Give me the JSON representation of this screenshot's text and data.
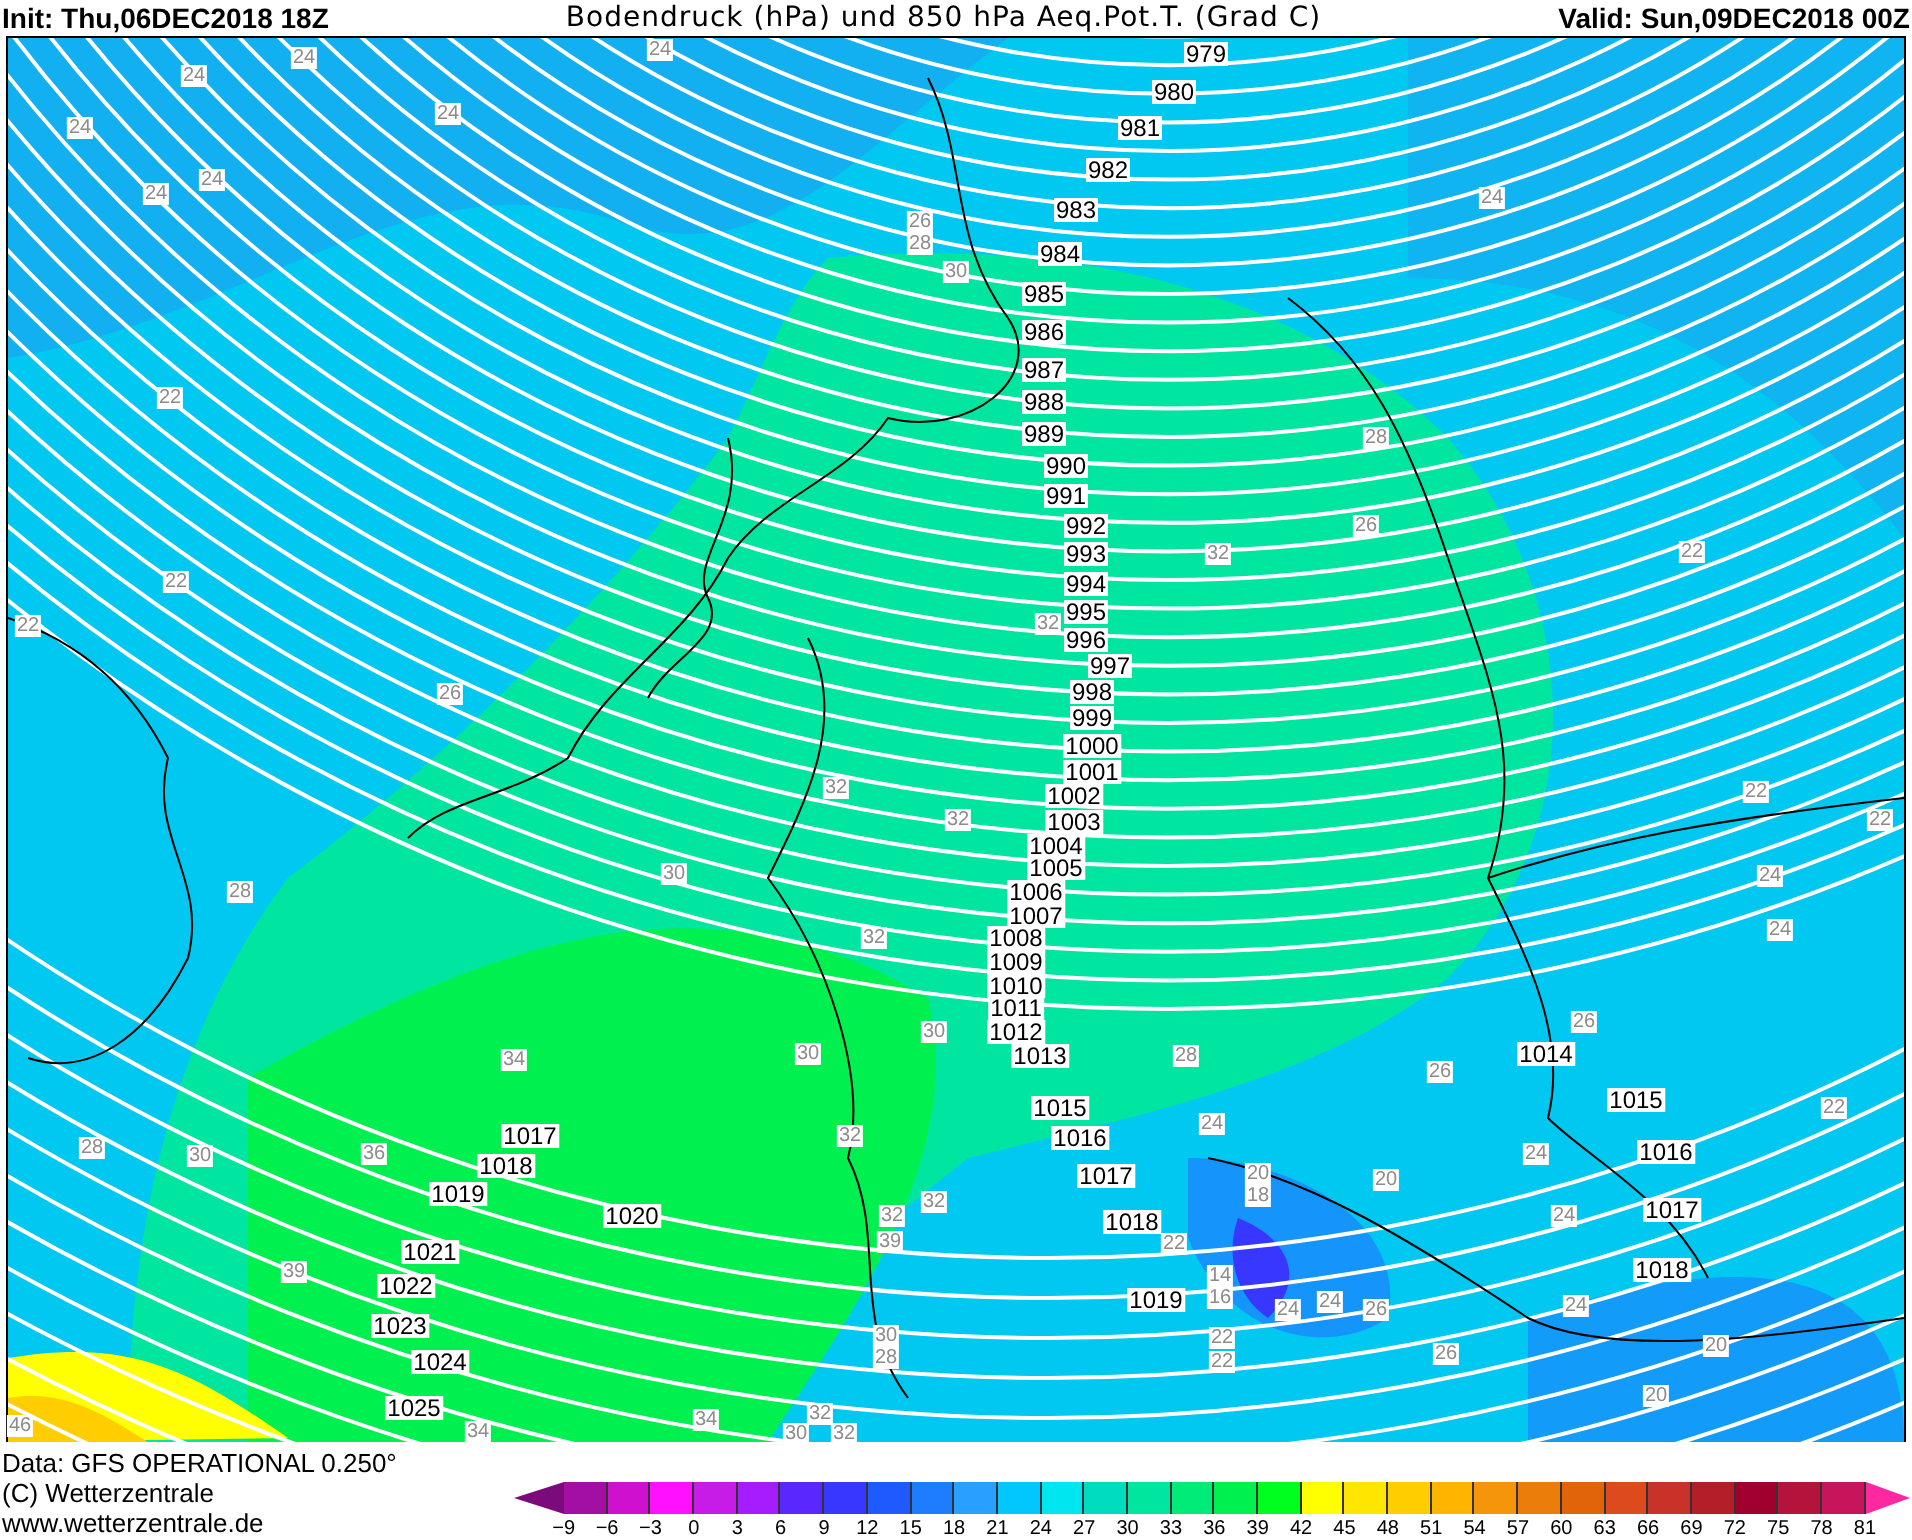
{
  "header": {
    "init": "Init: Thu,06DEC2018 18Z",
    "title": "Bodendruck (hPa) und 850 hPa Aeq.Pot.T. (Grad C)",
    "valid": "Valid: Sun,09DEC2018 00Z"
  },
  "map": {
    "pressure_labels": [
      "979",
      "980",
      "981",
      "982",
      "983",
      "984",
      "985",
      "986",
      "987",
      "988",
      "989",
      "990",
      "991",
      "992",
      "993",
      "994",
      "995",
      "996",
      "997",
      "998",
      "999",
      "1000",
      "1001",
      "1002",
      "1003",
      "1004",
      "1005",
      "1006",
      "1007",
      "1008",
      "1009",
      "1010",
      "1011",
      "1012",
      "1013",
      "1014",
      "1015",
      "1015",
      "1017",
      "1016",
      "1016",
      "1018",
      "1019",
      "1017",
      "1020",
      "1018",
      "1017",
      "1021",
      "1022",
      "1018",
      "1019",
      "1023",
      "1024",
      "1025"
    ],
    "temperature_labels": [
      "24",
      "24",
      "24",
      "24",
      "24",
      "24",
      "24",
      "24",
      "26",
      "28",
      "30",
      "22",
      "28",
      "26",
      "32",
      "22",
      "22",
      "22",
      "32",
      "26",
      "32",
      "22",
      "32",
      "22",
      "28",
      "30",
      "24",
      "32",
      "24",
      "30",
      "26",
      "34",
      "30",
      "28",
      "26",
      "22",
      "28",
      "30",
      "36",
      "32",
      "24",
      "24",
      "32",
      "32",
      "20",
      "18",
      "20",
      "24",
      "39",
      "22",
      "39",
      "14",
      "16",
      "24",
      "24",
      "26",
      "24",
      "30",
      "28",
      "22",
      "22",
      "26",
      "20",
      "20",
      "46",
      "34",
      "34",
      "30",
      "32",
      "32"
    ]
  },
  "footer": {
    "lines": [
      "Data: GFS OPERATIONAL 0.250°",
      "(C) Wetterzentrale",
      "www.wetterzentrale.de"
    ]
  },
  "legend": {
    "swatches": [
      {
        "kind": "below",
        "color": "#7d0a7d"
      },
      {
        "kind": "band",
        "color": "#a30fa3"
      },
      {
        "kind": "band",
        "color": "#cf10cf"
      },
      {
        "kind": "band",
        "color": "#ff10ff"
      },
      {
        "kind": "band",
        "color": "#c71ce8"
      },
      {
        "kind": "band",
        "color": "#a51cff"
      },
      {
        "kind": "band",
        "color": "#5a28ff"
      },
      {
        "kind": "band",
        "color": "#3737ff"
      },
      {
        "kind": "band",
        "color": "#1e5aff"
      },
      {
        "kind": "band",
        "color": "#1e7dff"
      },
      {
        "kind": "band",
        "color": "#28a0ff"
      },
      {
        "kind": "band",
        "color": "#00c8ff"
      },
      {
        "kind": "band",
        "color": "#00e6f0"
      },
      {
        "kind": "band",
        "color": "#00dcbe"
      },
      {
        "kind": "band",
        "color": "#00e6a0"
      },
      {
        "kind": "band",
        "color": "#00eb78"
      },
      {
        "kind": "band",
        "color": "#00f050"
      },
      {
        "kind": "band",
        "color": "#00ff1e"
      },
      {
        "kind": "band",
        "color": "#ffff00"
      },
      {
        "kind": "band",
        "color": "#ffe600"
      },
      {
        "kind": "band",
        "color": "#ffcd00"
      },
      {
        "kind": "band",
        "color": "#ffb400"
      },
      {
        "kind": "band",
        "color": "#f5960a"
      },
      {
        "kind": "band",
        "color": "#eb7d0a"
      },
      {
        "kind": "band",
        "color": "#e1640a"
      },
      {
        "kind": "band",
        "color": "#dc4b1e"
      },
      {
        "kind": "band",
        "color": "#c83228"
      },
      {
        "kind": "band",
        "color": "#b41e28"
      },
      {
        "kind": "band",
        "color": "#a0002d"
      },
      {
        "kind": "band",
        "color": "#b4143c"
      },
      {
        "kind": "band",
        "color": "#c8145a"
      },
      {
        "kind": "above",
        "color": "#ff28a0"
      }
    ],
    "ticks": [
      "−9",
      "−6",
      "−3",
      "0",
      "3",
      "6",
      "9",
      "12",
      "15",
      "18",
      "21",
      "24",
      "27",
      "30",
      "33",
      "36",
      "39",
      "42",
      "45",
      "48",
      "51",
      "54",
      "57",
      "60",
      "63",
      "66",
      "69",
      "72",
      "75",
      "78",
      "81"
    ]
  }
}
